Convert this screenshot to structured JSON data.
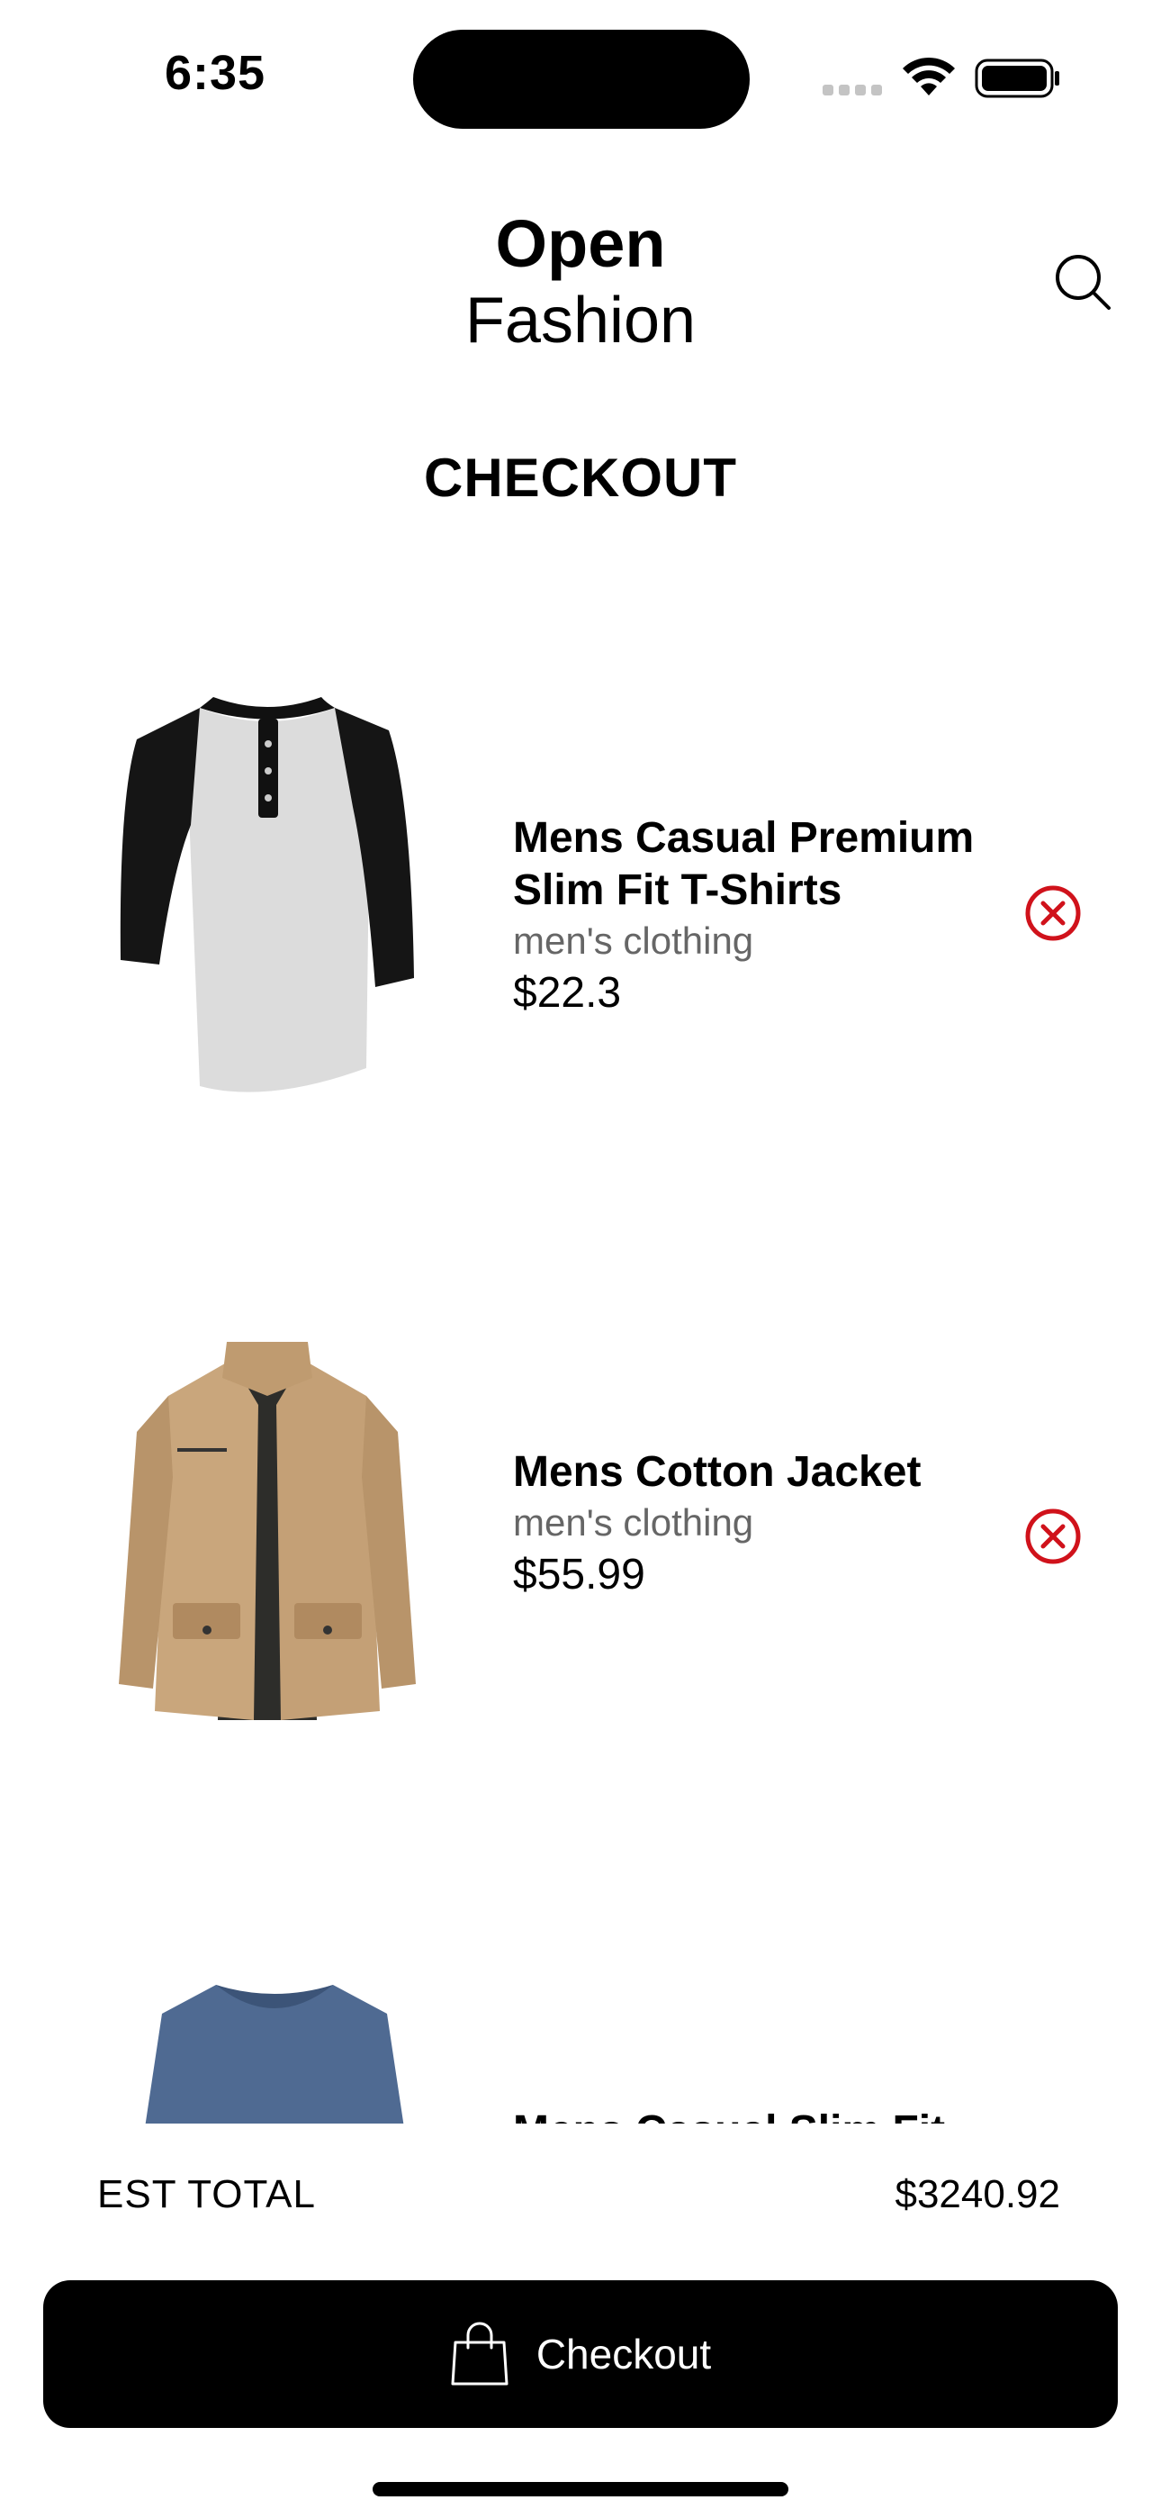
{
  "status_bar": {
    "time": "6:35"
  },
  "header": {
    "brand_line1": "Open",
    "brand_line2": "Fashion",
    "search_icon": "search-icon"
  },
  "page": {
    "title": "CHECKOUT"
  },
  "cart": {
    "items": [
      {
        "title": "Mens Casual Premium Slim Fit T-Shirts",
        "category": "men's clothing",
        "price": "$22.3",
        "image": "raglan-henley-tshirt",
        "remove_icon": "remove-x-circle-icon"
      },
      {
        "title": "Mens Cotton Jacket",
        "category": "men's clothing",
        "price": "$55.99",
        "image": "khaki-cotton-jacket",
        "remove_icon": "remove-x-circle-icon"
      },
      {
        "title": "Mens Casual Slim Fit",
        "image": "blue-vneck-longsleeve"
      }
    ]
  },
  "summary": {
    "total_label": "EST TOTAL",
    "total_value": "$3240.92"
  },
  "checkout": {
    "label": "Checkout",
    "icon": "shopping-bag-icon"
  },
  "colors": {
    "remove": "#D0121B",
    "primary": "#000000",
    "secondary_text": "#666666"
  }
}
